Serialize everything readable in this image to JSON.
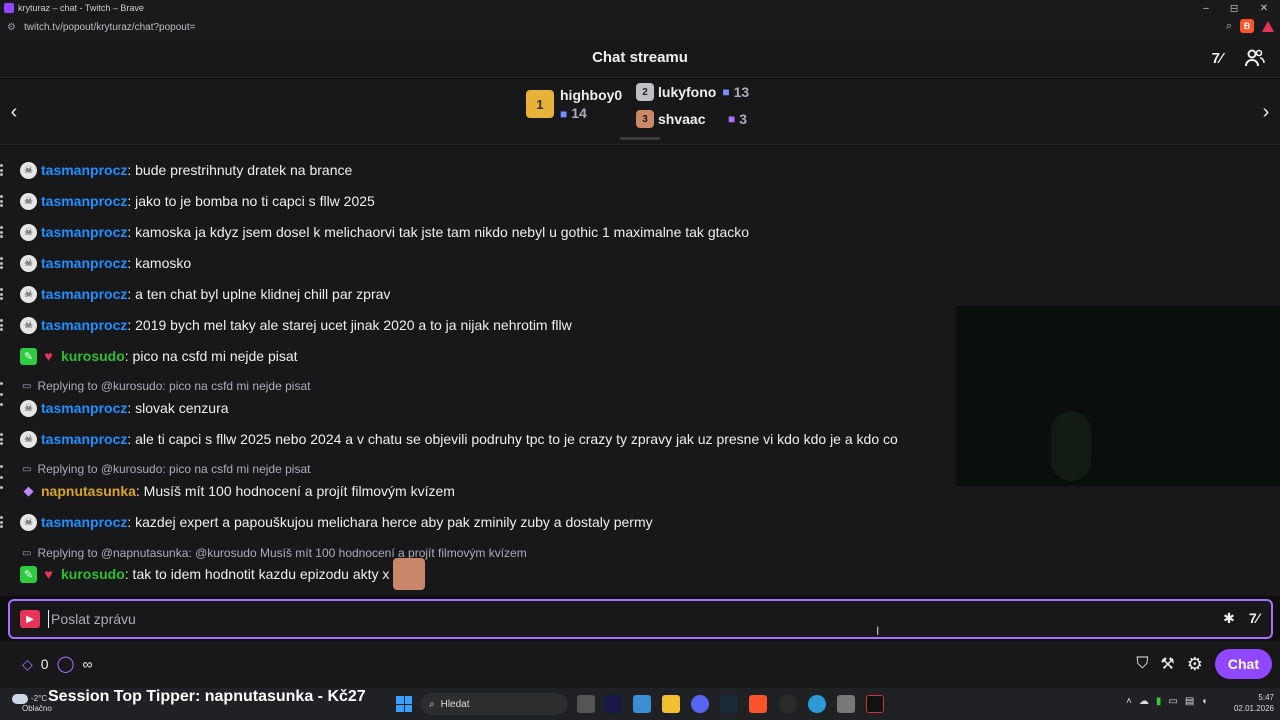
{
  "window": {
    "title": "kryturaz – chat - Twitch – Brave",
    "url": "twitch.tv/popout/kryturaz/chat?popout=",
    "min": "–",
    "max": "◻",
    "close": "✕"
  },
  "header": {
    "title": "Chat streamu"
  },
  "gifters": [
    {
      "rank": "1",
      "name": "highboy0",
      "count": "14"
    },
    {
      "rank": "2",
      "name": "lukyfono",
      "count": "13"
    },
    {
      "rank": "3",
      "name": "shvaac",
      "count": "3"
    }
  ],
  "messages": [
    {
      "user": "tasmanprocz",
      "text": ": bude prestrihnuty dratek na brance"
    },
    {
      "user": "tasmanprocz",
      "text": ": jako to je bomba no ti capci s fllw 2025"
    },
    {
      "user": "tasmanprocz",
      "text": ": kamoska ja kdyz jsem dosel k melichaorvi tak jste tam nikdo nebyl u gothic 1 maximalne tak gtacko"
    },
    {
      "user": "tasmanprocz",
      "text": ": kamosko"
    },
    {
      "user": "tasmanprocz",
      "text": ": a ten chat byl uplne klidnej chill par zprav"
    },
    {
      "user": "tasmanprocz",
      "text": ": 2019 bych mel taky ale starej ucet jinak 2020 a to ja nijak nehrotim fllw"
    },
    {
      "user": "kurosudo",
      "text": ": pico na csfd mi nejde pisat"
    },
    {
      "reply": "Replying to @kurosudo: pico na csfd mi nejde pisat",
      "user": "tasmanprocz",
      "text": ": slovak cenzura"
    },
    {
      "user": "tasmanprocz",
      "text": ": ale ti capci s fllw 2025 nebo 2024 a v chatu se objevili podruhy tpc to je crazy ty zpravy jak uz presne vi kdo kdo je a kdo co"
    },
    {
      "reply": "Replying to @kurosudo: pico na csfd mi nejde pisat",
      "user": "napnutasunka",
      "text": ": Musíš mít 100 hodnocení a projít filmovým kvízem"
    },
    {
      "user": "tasmanprocz",
      "text": ": kazdej expert a papouškujou melichara herce aby pak zminily zuby a dostaly permy"
    },
    {
      "reply": "Replying to @napnutasunka: @kurosudo Musíš mít 100 hodnocení a projít filmovým kvízem",
      "user": "kurosudo",
      "text": ": tak to idem hodnotit kazdu epizodu akty x"
    }
  ],
  "input": {
    "placeholder": "Poslat zprávu"
  },
  "bottom": {
    "points": "0",
    "infinity": "∞",
    "chat_button": "Chat"
  },
  "taskbar": {
    "tipper": "Session Top Tipper: napnutasunka - Kč27",
    "temp": "-2°C",
    "weather": "Oblačno",
    "search": "Hledat",
    "time": "5:47",
    "date": "02.01.2026"
  }
}
